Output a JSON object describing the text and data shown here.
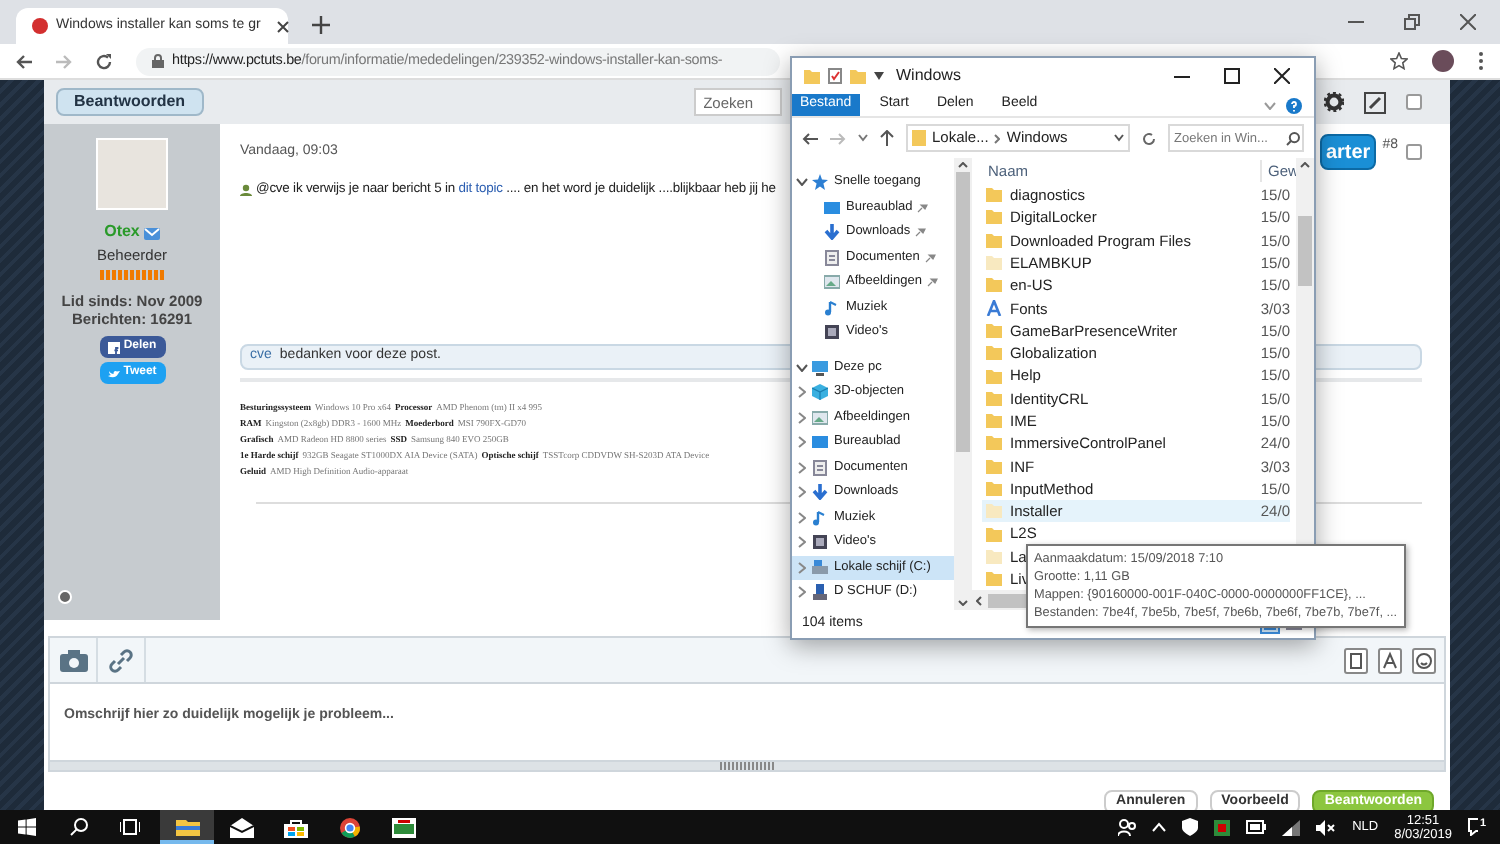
{
  "browser": {
    "tab_title": "Windows installer kan soms te gr",
    "url_host": "https://www.pctuts.be",
    "url_path": "/forum/informatie/mededelingen/239352-windows-installer-kan-soms-"
  },
  "forum": {
    "reply_button": "Beantwoorden",
    "search_placeholder": "Zoeken",
    "post": {
      "date": "Vandaag, 09:03",
      "author": "Otex",
      "role": "Beheerder",
      "member_since": "Lid sinds: Nov 2009",
      "posts": "Berichten: 16291",
      "share_buttons": [
        {
          "label": "Delen",
          "kind": "facebook"
        },
        {
          "label": "Tweet",
          "kind": "twitter"
        }
      ],
      "starter_button": "arter",
      "post_number": "#8",
      "message": "@cve ik verwijs je naar bericht 5 in **dit topic** .... en het word je duidelijk ....blijkbaar heb jij he",
      "thanks_user": "cve",
      "thanks_text": "bedanken voor deze post.",
      "specs": [
        {
          "label": "Besturingssysteem",
          "value": "Windows 10 Pro x64"
        },
        {
          "label": "Processor",
          "value": "AMD Phenom (tm) II x4 995"
        },
        {
          "label": "RAM",
          "value": "Kingston (2x8gb) DDR3 - 1600 MHz"
        },
        {
          "label": "Moederbord",
          "value": "MSI 790FX-GD70"
        },
        {
          "label": "Grafisch",
          "value": "AMD Radeon HD 8800 series"
        },
        {
          "label": "SSD",
          "value": "Samsung 840 EVO 250GB"
        },
        {
          "label": "1e Harde schijf",
          "value": "932GB Seagate ST1000DX AIA Device (SATA)"
        },
        {
          "label": "Optische schijf",
          "value": "TSSTcorp CDDVDW SH-S203D ATA Device"
        },
        {
          "label": "Geluid",
          "value": "AMD High Definition Audio-apparaat"
        }
      ]
    },
    "editor": {
      "placeholder": "Omschrijf hier zo duidelijk mogelijk je probleem...",
      "buttons": [
        {
          "label": "Annuleren",
          "primary": false
        },
        {
          "label": "Voorbeeld",
          "primary": false
        },
        {
          "label": "Beantwoorden",
          "primary": true
        }
      ]
    }
  },
  "explorer": {
    "title": "Windows",
    "ribbon_tabs": [
      {
        "label": "Bestand",
        "selected": true
      },
      {
        "label": "Start",
        "selected": false
      },
      {
        "label": "Delen",
        "selected": false
      },
      {
        "label": "Beeld",
        "selected": false
      }
    ],
    "breadcrumb": [
      "Lokale...",
      "Windows"
    ],
    "search_placeholder": "Zoeken in Win...",
    "nav": [
      {
        "label": "Snelle toegang",
        "kind": "star",
        "expanded": true,
        "selected": false,
        "children": [
          {
            "label": "Bureaublad",
            "kind": "desktop",
            "pinned": true,
            "selected": false
          },
          {
            "label": "Downloads",
            "kind": "download",
            "pinned": true,
            "selected": false
          },
          {
            "label": "Documenten",
            "kind": "document",
            "pinned": true,
            "selected": false
          },
          {
            "label": "Afbeeldingen",
            "kind": "picture",
            "pinned": true,
            "selected": false
          },
          {
            "label": "Muziek",
            "kind": "music",
            "pinned": false,
            "selected": false
          },
          {
            "label": "Video's",
            "kind": "video",
            "pinned": false,
            "selected": false
          }
        ]
      },
      {
        "label": "Deze pc",
        "kind": "pc",
        "expanded": true,
        "selected": false,
        "children": [
          {
            "label": "3D-objecten",
            "kind": "cube",
            "expanded": false,
            "selected": false
          },
          {
            "label": "Afbeeldingen",
            "kind": "picture",
            "expanded": false,
            "selected": false
          },
          {
            "label": "Bureaublad",
            "kind": "desktop",
            "expanded": false,
            "selected": false
          },
          {
            "label": "Documenten",
            "kind": "document",
            "expanded": false,
            "selected": false
          },
          {
            "label": "Downloads",
            "kind": "download",
            "expanded": false,
            "selected": false
          },
          {
            "label": "Muziek",
            "kind": "music",
            "expanded": false,
            "selected": false
          },
          {
            "label": "Video's",
            "kind": "video",
            "expanded": false,
            "selected": false
          },
          {
            "label": "Lokale schijf (C:)",
            "kind": "drive",
            "expanded": false,
            "selected": true
          },
          {
            "label": "D SCHUF (D:)",
            "kind": "usb",
            "expanded": false,
            "selected": false
          }
        ]
      }
    ],
    "columns": [
      "Naam",
      "Gew"
    ],
    "files": [
      {
        "name": "diagnostics",
        "date": "15/0",
        "kind": "folder",
        "hidden": false,
        "selected": false
      },
      {
        "name": "DigitalLocker",
        "date": "15/0",
        "kind": "folder",
        "hidden": false,
        "selected": false
      },
      {
        "name": "Downloaded Program Files",
        "date": "15/0",
        "kind": "folder",
        "hidden": false,
        "selected": false
      },
      {
        "name": "ELAMBKUP",
        "date": "15/0",
        "kind": "folder",
        "hidden": true,
        "selected": false
      },
      {
        "name": "en-US",
        "date": "15/0",
        "kind": "folder",
        "hidden": false,
        "selected": false
      },
      {
        "name": "Fonts",
        "date": "3/03",
        "kind": "fonts",
        "hidden": false,
        "selected": false
      },
      {
        "name": "GameBarPresenceWriter",
        "date": "15/0",
        "kind": "folder",
        "hidden": false,
        "selected": false
      },
      {
        "name": "Globalization",
        "date": "15/0",
        "kind": "folder",
        "hidden": false,
        "selected": false
      },
      {
        "name": "Help",
        "date": "15/0",
        "kind": "folder",
        "hidden": false,
        "selected": false
      },
      {
        "name": "IdentityCRL",
        "date": "15/0",
        "kind": "folder",
        "hidden": false,
        "selected": false
      },
      {
        "name": "IME",
        "date": "15/0",
        "kind": "folder",
        "hidden": false,
        "selected": false
      },
      {
        "name": "ImmersiveControlPanel",
        "date": "24/0",
        "kind": "folder",
        "hidden": false,
        "selected": false
      },
      {
        "name": "INF",
        "date": "3/03",
        "kind": "folder",
        "hidden": false,
        "selected": false
      },
      {
        "name": "InputMethod",
        "date": "15/0",
        "kind": "folder",
        "hidden": false,
        "selected": false
      },
      {
        "name": "Installer",
        "date": "24/0",
        "kind": "folder",
        "hidden": true,
        "selected": true
      },
      {
        "name": "L2S",
        "kind": "folder",
        "hidden": false,
        "selected": false
      },
      {
        "name": "La",
        "kind": "folder",
        "hidden": true,
        "selected": false
      },
      {
        "name": "Liv",
        "kind": "folder",
        "hidden": false,
        "selected": false
      }
    ],
    "status": "104 items",
    "tooltip": [
      "Aanmaakdatum: 15/09/2018 7:10",
      "Grootte: 1,11 GB",
      "Mappen: {90160000-001F-040C-0000-0000000FF1CE}, ...",
      "Bestanden: 7be4f, 7be5b, 7be5f, 7be6b, 7be6f, 7be7b, 7be7f, ..."
    ]
  },
  "taskbar": {
    "apps": [
      {
        "kind": "explorer",
        "selected": true
      },
      {
        "kind": "mail",
        "selected": false
      },
      {
        "kind": "store",
        "selected": false
      },
      {
        "kind": "chrome",
        "selected": false
      },
      {
        "kind": "game",
        "selected": false
      }
    ],
    "language": "NLD",
    "time": "12:51",
    "date": "8/03/2019",
    "notifications": "1"
  }
}
